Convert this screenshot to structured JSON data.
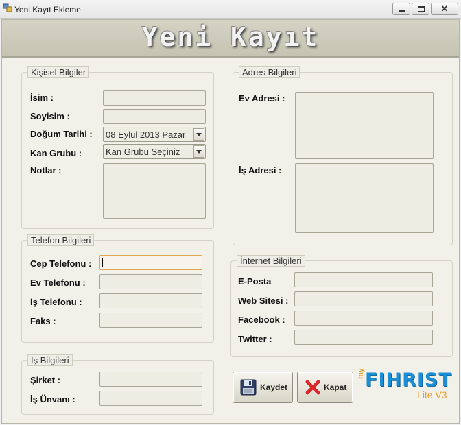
{
  "window": {
    "title": "Yeni Kayıt Ekleme"
  },
  "banner": {
    "title": "Yeni Kayıt"
  },
  "personal": {
    "legend": "Kişisel Bilgiler",
    "name_label": "İsim :",
    "surname_label": "Soyisim :",
    "birthdate_label": "Doğum Tarihi :",
    "birthdate_value": "08 Eylül 2013 Pazar",
    "blood_label": "Kan Grubu :",
    "blood_value": "Kan Grubu Seçiniz",
    "notes_label": "Notlar :"
  },
  "address": {
    "legend": "Adres Bilgileri",
    "home_label": "Ev Adresi :",
    "work_label": "İş Adresi :"
  },
  "phone": {
    "legend": "Telefon Bilgileri",
    "mobile_label": "Cep Telefonu :",
    "home_label": "Ev Telefonu :",
    "work_label": "İş Telefonu :",
    "fax_label": "Faks :"
  },
  "internet": {
    "legend": "İnternet Bilgileri",
    "email_label": "E-Posta",
    "website_label": "Web Sitesi :",
    "facebook_label": "Facebook :",
    "twitter_label": "Twitter :"
  },
  "job": {
    "legend": "İş Bilgileri",
    "company_label": "Şirket :",
    "title_label": "İş Ünvanı :"
  },
  "actions": {
    "save_label": "Kaydet",
    "close_label": "Kapat"
  },
  "logo": {
    "prefix": "my",
    "name": "FIHRIST",
    "edition": "Lite V3"
  },
  "colors": {
    "banner": "#c9c7b6",
    "panel": "#f2f1e9",
    "focus_border": "#e2a64f",
    "logo_blue": "#1b8ed6",
    "logo_orange": "#e89b28"
  }
}
